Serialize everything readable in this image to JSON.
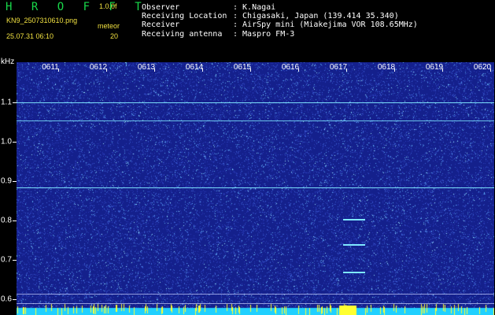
{
  "header": {
    "brand": "H R O F F T",
    "version": "1.0.0f",
    "filename": "KN9_2507310610.png",
    "timestamp": "25.07.31 06:10",
    "meteor_label": "meteor",
    "meteor_count": "20",
    "info": [
      {
        "key": "Observer",
        "value": ": K.Nagai"
      },
      {
        "key": "Receiving Location",
        "value": ": Chigasaki, Japan (139.414 35.340)"
      },
      {
        "key": "Receiver",
        "value": ": AirSpy mini (Miakejima VOR 108.65MHz)"
      },
      {
        "key": "Receiving antenna",
        "value": ": Maspro FM-3"
      }
    ]
  },
  "chart_data": {
    "type": "heatmap",
    "ylabel": "kHz",
    "x_ticks": [
      "0611",
      "0612",
      "0613",
      "0614",
      "0615",
      "0616",
      "0617",
      "0618",
      "0619",
      "0620"
    ],
    "y_ticks": [
      "1.1",
      "1.0",
      "0.9",
      "0.8",
      "0.7",
      "0.6"
    ],
    "y_range": [
      0.57,
      1.14
    ],
    "carriers_khz": [
      1.1,
      1.055,
      0.885
    ],
    "meteor_echo_khz": [
      0.805,
      0.74,
      0.67
    ],
    "colors": {
      "background": "#14208c",
      "signal": "#7fe8ff",
      "strong": "#ffff30"
    }
  }
}
